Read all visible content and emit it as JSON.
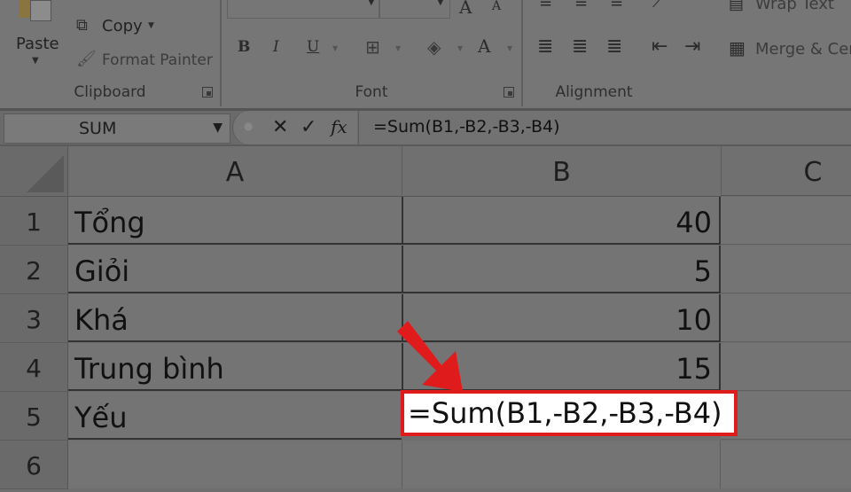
{
  "ribbon": {
    "clipboard": {
      "label": "Clipboard",
      "paste_label": "Paste",
      "copy_label": "Copy",
      "format_painter_label": "Format Painter"
    },
    "font": {
      "label": "Font",
      "bold": "B",
      "italic": "I",
      "underline": "U",
      "grow_font": "A",
      "font_color": "A"
    },
    "alignment": {
      "label": "Alignment",
      "wrap_text_label": "Wrap Text",
      "merge_label": "Merge & Center"
    }
  },
  "formula_bar": {
    "name_box": "SUM",
    "cancel_icon": "✕",
    "enter_icon": "✓",
    "fx_label": "fx",
    "formula": "=Sum(B1,-B2,-B3,-B4)"
  },
  "columns": [
    "A",
    "B",
    "C"
  ],
  "rows": [
    {
      "num": "1",
      "a": "Tổng",
      "b": "40"
    },
    {
      "num": "2",
      "a": "Giỏi",
      "b": "5"
    },
    {
      "num": "3",
      "a": "Khá",
      "b": "10"
    },
    {
      "num": "4",
      "a": "Trung bình",
      "b": "15"
    },
    {
      "num": "5",
      "a": "Yếu",
      "b": ""
    },
    {
      "num": "6",
      "a": "",
      "b": ""
    }
  ],
  "editing_cell": {
    "ref": "B5",
    "value": "=Sum(B1,-B2,-B3,-B4)"
  },
  "annotation": {
    "highlight_color": "#e01b1b"
  }
}
